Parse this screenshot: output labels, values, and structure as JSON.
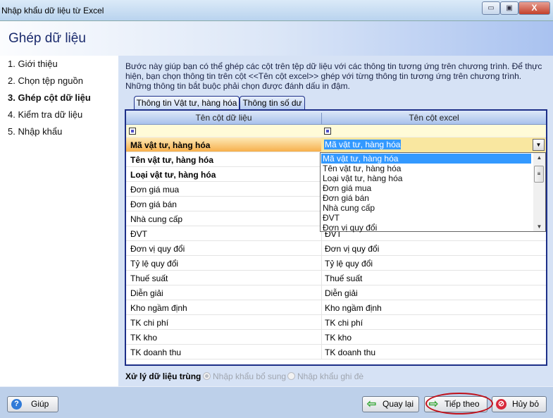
{
  "window": {
    "title": "Nhập khẩu dữ liệu từ Excel",
    "minimize": "▭",
    "maximize": "▣",
    "close": "X"
  },
  "header": {
    "title": "Ghép dữ liệu"
  },
  "steps": [
    {
      "label": "1. Giới thiệu"
    },
    {
      "label": "2. Chọn tệp nguồn"
    },
    {
      "label": "3. Ghép cột dữ liệu",
      "active": true
    },
    {
      "label": "4. Kiểm tra dữ liệu"
    },
    {
      "label": "5. Nhập khẩu"
    }
  ],
  "description": "Bước này giúp bạn có thể ghép các cột trên tệp dữ liệu với các thông tin tương ứng trên chương trình. Để thực hiện, bạn chọn thông tin trên cột <<Tên cột excel>> ghép với từng thông tin tương ứng trên chương trình. Những thông tin bắt buộc phải chọn được đánh dấu in đậm.",
  "tabs": [
    {
      "label": "Thông tin Vật tư, hàng hóa"
    },
    {
      "label": "Thông tin số dư"
    }
  ],
  "grid": {
    "columns": [
      "Tên cột dữ liệu",
      "Tên cột excel"
    ],
    "rows": [
      {
        "field": "Mã vật tư, hàng hóa",
        "excel": "Mã vật tư, hàng hóa"
      },
      {
        "field": "Tên vật tư, hàng hóa",
        "excel": ""
      },
      {
        "field": "Loại vật tư, hàng hóa",
        "excel": ""
      },
      {
        "field": "Đơn giá mua",
        "excel": ""
      },
      {
        "field": "Đơn giá bán",
        "excel": ""
      },
      {
        "field": "Nhà cung cấp",
        "excel": ""
      },
      {
        "field": "ĐVT",
        "excel": "ĐVT"
      },
      {
        "field": "Đơn vị quy đổi",
        "excel": "Đơn vị quy đổi"
      },
      {
        "field": "Tỷ lệ quy đổi",
        "excel": "Tỷ lệ quy đổi"
      },
      {
        "field": "Thuế suất",
        "excel": "Thuế suất"
      },
      {
        "field": "Diễn giải",
        "excel": "Diễn giải"
      },
      {
        "field": "Kho ngầm định",
        "excel": "Kho ngầm định"
      },
      {
        "field": "TK chi phí",
        "excel": "TK chi phí"
      },
      {
        "field": "TK kho",
        "excel": "TK kho"
      },
      {
        "field": "TK doanh thu",
        "excel": "TK doanh thu"
      }
    ],
    "dropdown_options": [
      "Mã vật tư, hàng hóa",
      "Tên vật tư, hàng hóa",
      "Loại vật tư, hàng hóa",
      "Đơn giá mua",
      "Đơn giá bán",
      "Nhà cung cấp",
      "ĐVT",
      "Đơn vị quy đổi"
    ]
  },
  "duplicate": {
    "label": "Xử lý dữ liệu trùng",
    "options": [
      {
        "label": "Nhập khẩu bổ sung",
        "checked": true
      },
      {
        "label": "Nhập khẩu ghi đè",
        "checked": false
      }
    ]
  },
  "buttons": {
    "help": "Giúp",
    "back": "Quay lại",
    "next": "Tiếp theo",
    "cancel": "Hủy bỏ"
  },
  "colors": {
    "accent": "#1d2f88",
    "selected_row": "#f7b04c",
    "highlight": "#3399ff",
    "annotation": "#c0101a"
  }
}
